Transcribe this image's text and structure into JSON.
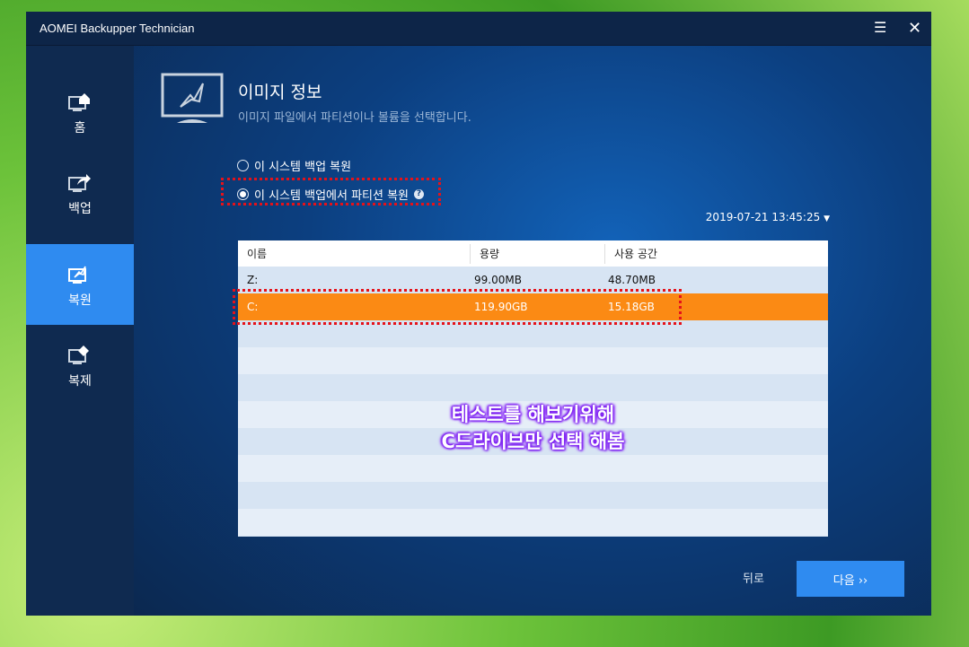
{
  "window": {
    "title": "AOMEI Backupper Technician",
    "menu_icon": "list-icon",
    "close_icon": "close-icon"
  },
  "sidebar": {
    "items": [
      {
        "label": "홈",
        "icon": "home-icon"
      },
      {
        "label": "백업",
        "icon": "backup-icon"
      },
      {
        "label": "복원",
        "icon": "restore-icon",
        "active": true
      },
      {
        "label": "복제",
        "icon": "clone-icon"
      }
    ]
  },
  "header": {
    "title": "이미지 정보",
    "subtitle": "이미지 파일에서 파티션이나 볼륨을 선택합니다."
  },
  "options": [
    {
      "label": "이 시스템 백업 복원",
      "selected": false
    },
    {
      "label": "이 시스템 백업에서 파티션 복원",
      "selected": true,
      "help": "?"
    }
  ],
  "backup_time": "2019-07-21 13:45:25",
  "table": {
    "columns": [
      "이름",
      "용량",
      "사용 공간"
    ],
    "rows": [
      {
        "name": "Z:",
        "capacity": "99.00MB",
        "used": "48.70MB"
      },
      {
        "name": "C:",
        "capacity": "119.90GB",
        "used": "15.18GB",
        "selected": true
      }
    ]
  },
  "annotation": {
    "line1": "테스트를 해보기위해",
    "line2": "C드라이브만 선택 해봄"
  },
  "footer": {
    "back": "뒤로",
    "next": "다음 ››"
  },
  "colors": {
    "accent": "#2f8bf0",
    "selected_row": "#fb8a14",
    "highlight": "#e5121a"
  }
}
